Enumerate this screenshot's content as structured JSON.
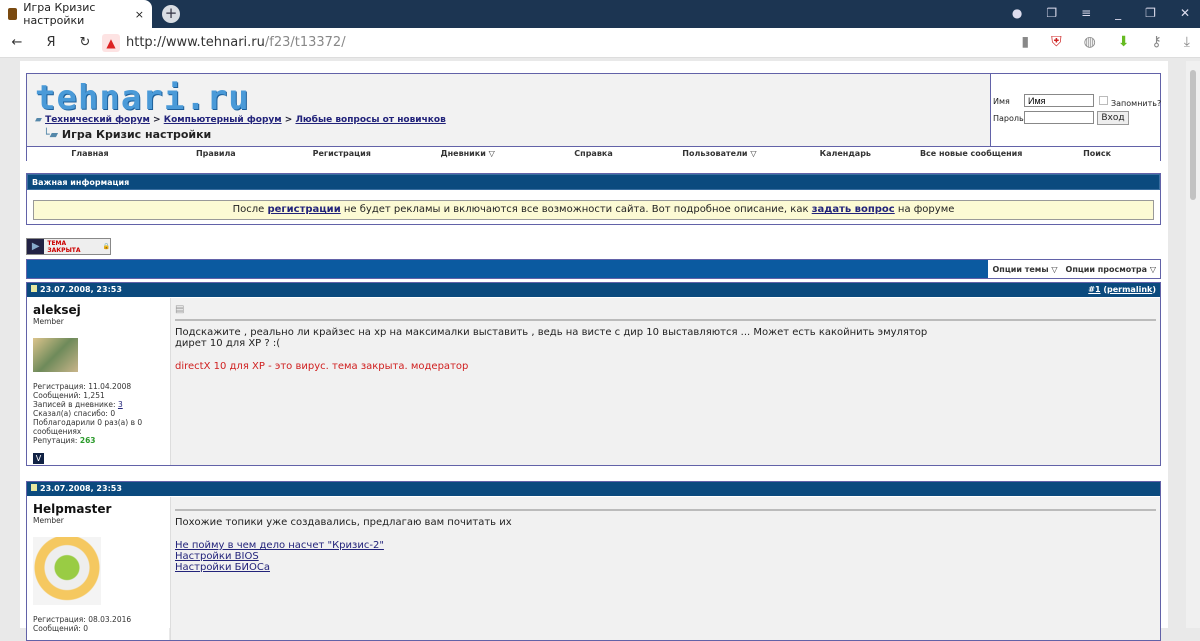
{
  "browser": {
    "tab_title": "Игра Кризис настройки",
    "new_tab": "+",
    "url_host": "http://www.tehnari.ru",
    "url_path": "/f23/t13372/"
  },
  "header": {
    "logo": "tehnari.ru",
    "breadcrumbs": [
      "Технический форум",
      "Компьютерный форум",
      "Любые вопросы от новичков"
    ],
    "sep": ">",
    "thread_title": "Игра Кризис настройки"
  },
  "login": {
    "name_label": "Имя",
    "name_value": "Имя",
    "password_label": "Пароль",
    "remember_label": "Запомнить?",
    "submit": "Вход"
  },
  "nav": [
    "Главная",
    "Правила",
    "Регистрация",
    "Дневники ▽",
    "Справка",
    "Пользователи ▽",
    "Календарь",
    "Все новые сообщения",
    "Поиск"
  ],
  "info": {
    "title": "Важная информация",
    "text1": "После ",
    "link1": "регистрации",
    "text2": " не будет рекламы и включаются все возможности сайта. Вот подробное описание, как ",
    "link2": "задать вопрос",
    "text3": " на форуме"
  },
  "closed_label": "ТЕМА ЗАКРЫТА",
  "toolbar": {
    "thread_options": "Опции темы ▽",
    "view_options": "Опции просмотра ▽"
  },
  "posts": [
    {
      "date": "23.07.2008, 23:53",
      "num": "#1",
      "permalink": "permalink",
      "user": "aleksej",
      "role": "Member",
      "reg": "Регистрация: 11.04.2008",
      "msgs": "Сообщений: 1,251",
      "diary_label": "Записей в дневнике: ",
      "diary": "3",
      "thanked": "Сказал(а) спасибо: 0",
      "thanks": "Поблагодарили 0 раз(а) в 0 сообщениях",
      "rep_label": "Репутация: ",
      "rep": "263",
      "line1": "Подскажите , реально ли крайзес на хр на максималки выставить , ведь на висте с дир 10 выставляются ... Может есть какойнить эмулятор",
      "line2": "дирет 10 для ХР ? :(",
      "mod": "directX 10 для XP - это вирус. тема закрыта. модератор"
    },
    {
      "date": "23.07.2008, 23:53",
      "user": "Helpmaster",
      "role": "Member",
      "reg": "Регистрация: 08.03.2016",
      "msgs": "Сообщений: 0",
      "text": "Похожие топики уже создавались, предлагаю вам почитать их",
      "links": [
        "Не пойму в чем дело насчет \"Кризис-2\"",
        "Настройки BIOS",
        "Настройки БИОСа"
      ]
    }
  ]
}
